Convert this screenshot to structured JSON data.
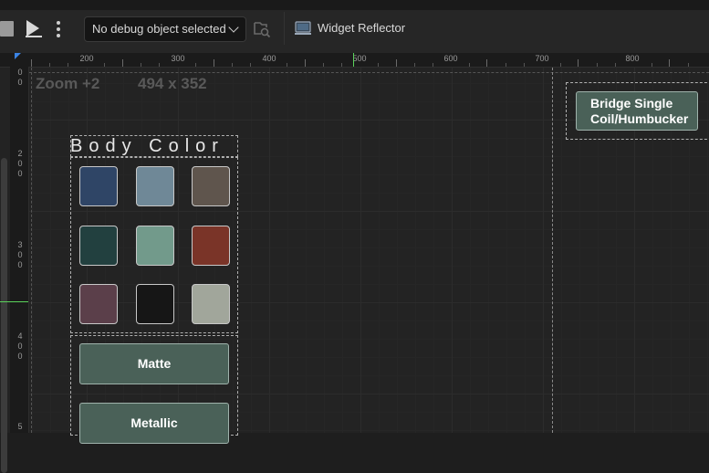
{
  "toolbar": {
    "debug_select": "No debug object selected",
    "widget_reflector": "Widget Reflector"
  },
  "ruler": {
    "h_labels": [
      "200",
      "300",
      "400",
      "500",
      "600",
      "700",
      "800"
    ],
    "v_labels": [
      [
        "0",
        "0"
      ],
      [
        "2",
        "0",
        "0"
      ],
      [
        "3",
        "0",
        "0"
      ],
      [
        "4",
        "0",
        "0"
      ],
      [
        "5"
      ]
    ]
  },
  "canvas": {
    "zoom": "Zoom +2",
    "size": "494 x 352"
  },
  "body_color": {
    "title": "Body Color",
    "swatches": [
      "#2f4566",
      "#6f8897",
      "#5f554d",
      "#22403f",
      "#729a8b",
      "#7a3428",
      "#5b3f4a",
      "#161616",
      "#a1a69b"
    ]
  },
  "finishes": [
    "Matte",
    "Metallic"
  ],
  "bridge_button": "Bridge Single\nCoil/Humbucker",
  "colors": {
    "accent_blue": "#3b84e5",
    "guide_green": "#5bd35b",
    "button_fill": "#4a6158"
  }
}
